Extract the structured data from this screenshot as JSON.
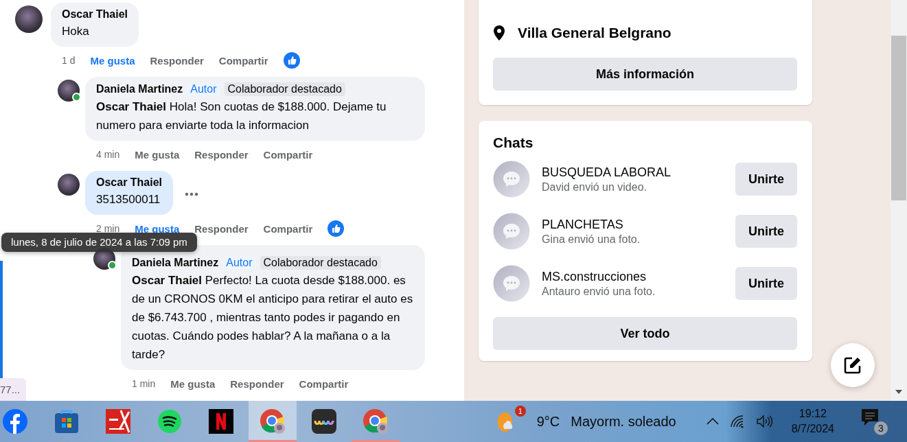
{
  "side_chip": "77...",
  "tooltip": "lunes, 8 de julio de 2024 a las 7:09 pm",
  "comments": [
    {
      "author": "Oscar Thaiel",
      "text": "Hoka",
      "time": "1 d",
      "time_hovered": false,
      "liked": true,
      "reaction": true,
      "online": false,
      "highlighted": false,
      "show_more": false,
      "actions": [
        "Me gusta",
        "Responder",
        "Compartir"
      ],
      "children": [
        {
          "author": "Daniela Martinez",
          "text": "**Oscar Thaiel** Hola! Son cuotas de $188.000. Dejame tu numero para enviarte toda la informacion",
          "time": "4 min",
          "time_hovered": false,
          "liked": false,
          "reaction": false,
          "online": true,
          "highlighted": false,
          "show_more": false,
          "badges": [
            {
              "label": "Autor",
              "kind": "author"
            },
            {
              "label": "Colaborador destacado",
              "kind": "contributor"
            }
          ],
          "actions": [
            "Me gusta",
            "Responder",
            "Compartir"
          ]
        },
        {
          "author": "Oscar Thaiel",
          "text": "3513500011",
          "time": "2 min",
          "time_hovered": true,
          "liked": true,
          "reaction": true,
          "online": false,
          "highlighted": true,
          "show_more": true,
          "actions": [
            "Me gusta",
            "Responder",
            "Compartir"
          ],
          "children": [
            {
              "author": "Daniela Martinez",
              "text": "**Oscar Thaiel** Perfecto! La cuota desde $188.000. es de un CRONOS 0KM el anticipo para retirar el auto es de $6.743.700 , mientras tanto podes ir pagando en cuotas. Cuándo podes hablar? A la mañana o a la tarde?",
              "time": "1 min",
              "time_hovered": false,
              "liked": false,
              "reaction": false,
              "online": true,
              "highlighted": false,
              "show_more": false,
              "badges": [
                {
                  "label": "Autor",
                  "kind": "author"
                },
                {
                  "label": "Colaborador destacado",
                  "kind": "contributor"
                }
              ],
              "actions": [
                "Me gusta",
                "Responder",
                "Compartir"
              ]
            }
          ]
        }
      ]
    }
  ],
  "about": {
    "location": "Villa General Belgrano",
    "button": "Más información"
  },
  "chats": {
    "title": "Chats",
    "items": [
      {
        "name": "BUSQUEDA LABORAL",
        "last": "David envió un video.",
        "button": "Unirte"
      },
      {
        "name": "PLANCHETAS",
        "last": "Gina envió una foto.",
        "button": "Unirte"
      },
      {
        "name": "MS.construcciones",
        "last": "Antauro envió una foto.",
        "button": "Unirte"
      }
    ],
    "button": "Ver todo"
  },
  "taskbar": {
    "apps": [
      {
        "kind": "facebook",
        "selected": false,
        "running": false
      },
      {
        "kind": "store",
        "selected": false,
        "running": false
      },
      {
        "kind": "pdf",
        "selected": false,
        "running": false
      },
      {
        "kind": "spotify",
        "selected": false,
        "running": false
      },
      {
        "kind": "netflix",
        "selected": false,
        "running": false
      },
      {
        "kind": "chrome",
        "selected": true,
        "running": true
      },
      {
        "kind": "wave",
        "selected": false,
        "running": false
      },
      {
        "kind": "chrome",
        "selected": false,
        "running": true
      }
    ],
    "weather_badge": "1",
    "temperature": "9°C",
    "condition": "Mayorm. soleado",
    "time": "19:12",
    "date": "8/7/2024",
    "notifications": "3"
  }
}
